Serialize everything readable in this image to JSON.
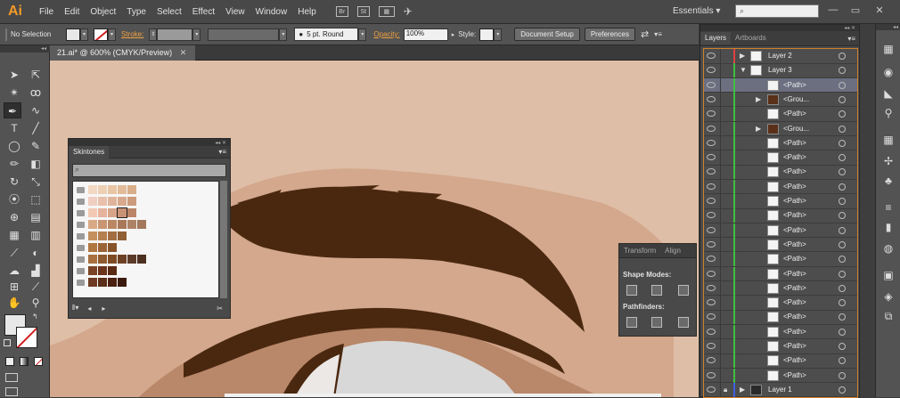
{
  "app": {
    "logo": "Ai"
  },
  "menu": [
    "File",
    "Edit",
    "Object",
    "Type",
    "Select",
    "Effect",
    "View",
    "Window",
    "Help"
  ],
  "menubar_icons": {
    "br": "Br",
    "st": "St"
  },
  "workspace": {
    "label": "Essentials",
    "search_placeholder": ""
  },
  "control_bar": {
    "selection": "No Selection",
    "stroke_label": "Stroke:",
    "brush": "5 pt. Round",
    "opacity_label": "Opacity:",
    "opacity_value": "100%",
    "style_label": "Style:",
    "doc_setup": "Document Setup",
    "preferences": "Preferences"
  },
  "document": {
    "tab": "21.ai* @ 600% (CMYK/Preview)"
  },
  "skintones_panel": {
    "title": "Skintones",
    "rows": [
      [
        "#f3d9c2",
        "#eed0b4",
        "#e8c5a5",
        "#e2bb99",
        "#d8ae89"
      ],
      [
        "#f0cfc0",
        "#e9c0ac",
        "#e0b49a",
        "#d8a88c",
        "#cc9a7c"
      ],
      [
        "#f2c9b4",
        "#e6b39c",
        "#d8a489",
        "#c89274",
        "#bb8467"
      ],
      [
        "#d9a986",
        "#c89673",
        "#b98763",
        "#a97858",
        "#ae8266",
        "#a3785d"
      ],
      [
        "#c5905f",
        "#b4804f",
        "#a26e41",
        "#8f5f35"
      ],
      [
        "#b07740",
        "#9b6435",
        "#87532a"
      ],
      [
        "#a8703f",
        "#8e5a2f",
        "#7d4b24",
        "#6d4024",
        "#5c3a28",
        "#4c3020"
      ],
      [
        "#7b4426",
        "#6b341c",
        "#5a2a14"
      ],
      [
        "#6e3c22",
        "#5a2e18",
        "#4a2010",
        "#3a1a0c"
      ]
    ]
  },
  "transform_panel": {
    "tab_transform": "Transform",
    "tab_align": "Align",
    "shape_modes": "Shape Modes:",
    "pathfinders": "Pathfinders:"
  },
  "layers_panel": {
    "tab_layers": "Layers",
    "tab_artboards": "Artboards",
    "rows": [
      {
        "name": "Layer 2",
        "indent": 0,
        "type": "layer",
        "color": "#e04040",
        "expand": "right"
      },
      {
        "name": "Layer 3",
        "indent": 0,
        "type": "layer",
        "color": "#40c040",
        "expand": "down"
      },
      {
        "name": "<Path>",
        "indent": 2,
        "type": "item",
        "color": "#40c040",
        "selected": true
      },
      {
        "name": "<Grou...",
        "indent": 1,
        "type": "group",
        "color": "#40c040",
        "expand": "right"
      },
      {
        "name": "<Path>",
        "indent": 2,
        "type": "item",
        "color": "#40c040"
      },
      {
        "name": "<Grou...",
        "indent": 1,
        "type": "group",
        "color": "#40c040",
        "expand": "right"
      },
      {
        "name": "<Path>",
        "indent": 2,
        "type": "item",
        "color": "#40c040"
      },
      {
        "name": "<Path>",
        "indent": 2,
        "type": "item",
        "color": "#40c040"
      },
      {
        "name": "<Path>",
        "indent": 2,
        "type": "item",
        "color": "#40c040"
      },
      {
        "name": "<Path>",
        "indent": 2,
        "type": "item",
        "color": "#40c040"
      },
      {
        "name": "<Path>",
        "indent": 2,
        "type": "item",
        "color": "#40c040"
      },
      {
        "name": "<Path>",
        "indent": 2,
        "type": "item",
        "color": "#40c040"
      },
      {
        "name": "<Path>",
        "indent": 2,
        "type": "item",
        "color": "#40c040"
      },
      {
        "name": "<Path>",
        "indent": 2,
        "type": "item",
        "color": "#40c040"
      },
      {
        "name": "<Path>",
        "indent": 2,
        "type": "item",
        "color": "#40c040"
      },
      {
        "name": "<Path>",
        "indent": 2,
        "type": "item",
        "color": "#40c040"
      },
      {
        "name": "<Path>",
        "indent": 2,
        "type": "item",
        "color": "#40c040"
      },
      {
        "name": "<Path>",
        "indent": 2,
        "type": "item",
        "color": "#40c040"
      },
      {
        "name": "<Path>",
        "indent": 2,
        "type": "item",
        "color": "#40c040"
      },
      {
        "name": "<Path>",
        "indent": 2,
        "type": "item",
        "color": "#40c040"
      },
      {
        "name": "<Path>",
        "indent": 2,
        "type": "item",
        "color": "#40c040"
      },
      {
        "name": "<Path>",
        "indent": 2,
        "type": "item",
        "color": "#40c040"
      },
      {
        "name": "<Path>",
        "indent": 2,
        "type": "item",
        "color": "#40c040"
      },
      {
        "name": "Layer 1",
        "indent": 0,
        "type": "layer",
        "color": "#4060e0",
        "expand": "right",
        "locked": true
      }
    ]
  },
  "colors": {
    "accent": "#f29a29",
    "selection_row": "#6b6f80",
    "skin": "#e0c0a8",
    "brow": "#4a2810"
  }
}
